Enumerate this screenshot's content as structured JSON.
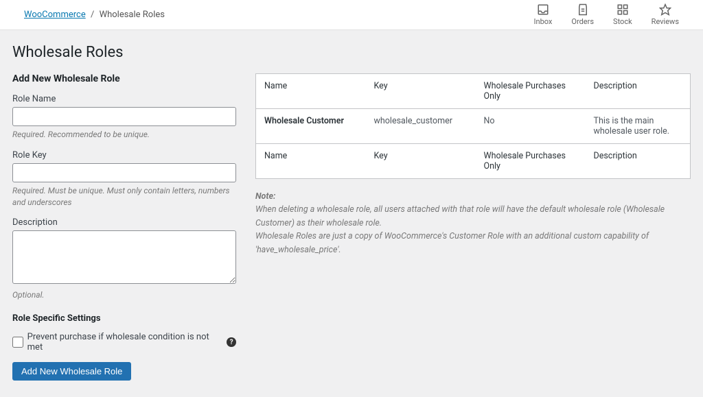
{
  "breadcrumb": {
    "root": "WooCommerce",
    "current": "Wholesale Roles"
  },
  "top_nav": {
    "inbox": "Inbox",
    "orders": "Orders",
    "stock": "Stock",
    "reviews": "Reviews"
  },
  "page": {
    "title": "Wholesale Roles"
  },
  "form": {
    "heading": "Add New Wholesale Role",
    "role_name": {
      "label": "Role Name",
      "hint": "Required. Recommended to be unique."
    },
    "role_key": {
      "label": "Role Key",
      "hint": "Required. Must be unique. Must only contain letters, numbers and underscores"
    },
    "description": {
      "label": "Description",
      "hint": "Optional."
    },
    "settings_heading": "Role Specific Settings",
    "prevent_purchase_label": "Prevent purchase if wholesale condition is not met",
    "submit": "Add New Wholesale Role"
  },
  "table": {
    "headers": {
      "name": "Name",
      "key": "Key",
      "wpo": "Wholesale Purchases Only",
      "desc": "Description"
    },
    "rows": [
      {
        "name": "Wholesale Customer",
        "key": "wholesale_customer",
        "wpo": "No",
        "desc": "This is the main wholesale user role."
      }
    ]
  },
  "note": {
    "title": "Note:",
    "line1": "When deleting a wholesale role, all users attached with that role will have the default wholesale role (Wholesale Customer) as their wholesale role.",
    "line2": "Wholesale Roles are just a copy of WooCommerce's Customer Role with an additional custom capability of 'have_wholesale_price'."
  }
}
